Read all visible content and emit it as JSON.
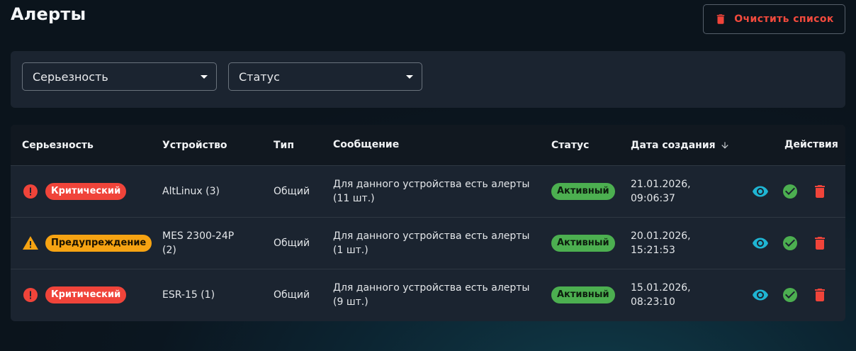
{
  "page": {
    "title": "Алерты"
  },
  "toolbar": {
    "clear_label": "Очистить список"
  },
  "filters": {
    "severity": {
      "label": "Серьезность"
    },
    "status": {
      "label": "Статус"
    }
  },
  "table": {
    "headers": {
      "severity": "Серьезность",
      "device": "Устройство",
      "type": "Тип",
      "message": "Сообщение",
      "status": "Статус",
      "created": "Дата создания",
      "actions": "Действия"
    },
    "rows": [
      {
        "severity": "Критический",
        "severity_icon": "error-icon",
        "device": "AltLinux (3)",
        "type": "Общий",
        "message": "Для данного устройства есть алерты\n(11 шт.)",
        "status": "Активный",
        "created": "21.01.2026,\n09:06:37"
      },
      {
        "severity": "Предупреждение",
        "severity_icon": "warning-icon",
        "device": "MES 2300-24P\n(2)",
        "type": "Общий",
        "message": "Для данного устройства есть алерты\n(1 шт.)",
        "status": "Активный",
        "created": "20.01.2026,\n15:21:53"
      },
      {
        "severity": "Критический",
        "severity_icon": "error-icon",
        "device": "ESR-15 (1)",
        "type": "Общий",
        "message": "Для данного устройства есть алерты\n(9 шт.)",
        "status": "Активный",
        "created": "15.01.2026,\n08:23:10"
      }
    ]
  },
  "colors": {
    "critical": "#f0443a",
    "warning": "#f6a312",
    "active": "#4caf50",
    "view_icon": "#1fb5d3",
    "confirm_icon": "#4caf50",
    "delete_icon": "#f0443a"
  }
}
